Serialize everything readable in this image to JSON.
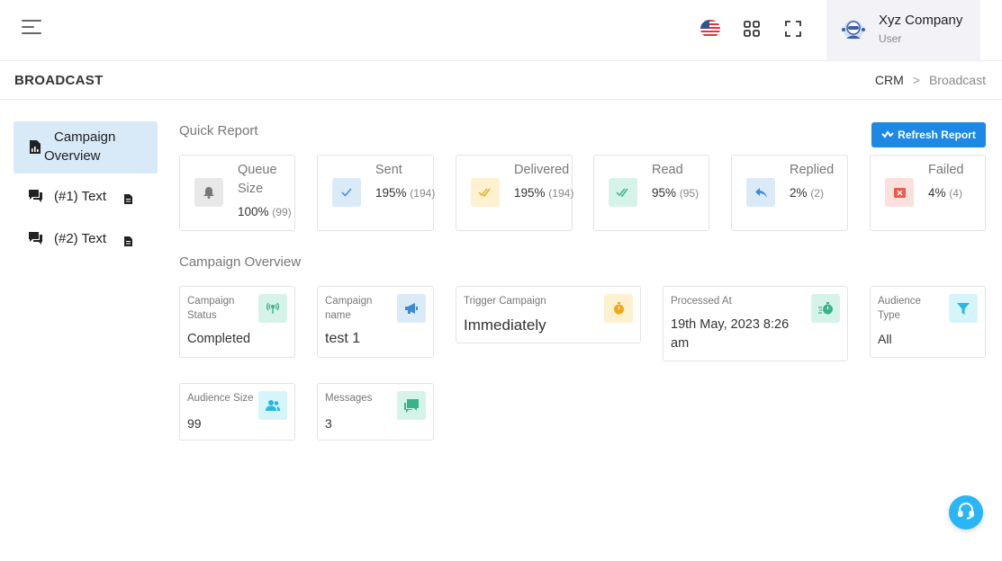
{
  "header": {
    "user_name": "Xyz Company",
    "user_role": "User",
    "icons": [
      "menu-icon",
      "us-flag-icon",
      "apps-grid-icon",
      "fullscreen-icon",
      "avatar-icon"
    ]
  },
  "page": {
    "title": "BROADCAST",
    "breadcrumb": {
      "root": "CRM",
      "separator": ">",
      "current": "Broadcast"
    }
  },
  "nav": {
    "items": [
      {
        "label_line1": "Campaign",
        "label_line2": "Overview",
        "icon": "report-icon",
        "active": true
      },
      {
        "label": "(#1) Text",
        "icon": "chat-icon",
        "suffix_icon": "document-icon"
      },
      {
        "label": "(#2) Text",
        "icon": "chat-icon",
        "suffix_icon": "document-icon"
      }
    ]
  },
  "quick_report": {
    "title": "Quick Report",
    "refresh_label": "Refresh Report",
    "cards": [
      {
        "title_line1": "Queue",
        "title_line2": "Size",
        "percent": "100%",
        "count": "(99)",
        "icon": "bell-icon",
        "color": "#e8e8e8"
      },
      {
        "title": "Sent",
        "percent": "195%",
        "count": "(194)",
        "icon": "check-icon",
        "color": "#dbeaf7"
      },
      {
        "title": "Delivered",
        "percent": "195%",
        "count": "(194)",
        "icon": "double-check-icon",
        "color": "#fdf1cf"
      },
      {
        "title": "Read",
        "percent": "95%",
        "count": "(95)",
        "icon": "double-check-icon",
        "color": "#d6f3ea"
      },
      {
        "title": "Replied",
        "percent": "2%",
        "count": "(2)",
        "icon": "reply-icon",
        "color": "#dbeaf7"
      },
      {
        "title": "Failed",
        "percent": "4%",
        "count": "(4)",
        "icon": "close-box-icon",
        "color": "#fbe0dd"
      }
    ]
  },
  "campaign_overview": {
    "title": "Campaign Overview",
    "cards": [
      {
        "label_line1": "Campaign",
        "label_line2": "Status",
        "value": "Completed",
        "icon": "broadcast-tower-icon",
        "color": "#d6f3ea"
      },
      {
        "label_line1": "Campaign",
        "label_line2": "name",
        "value": "test 1",
        "icon": "megaphone-icon",
        "color": "#dbeaf7"
      },
      {
        "label": "Trigger Campaign",
        "value": "Immediately",
        "icon": "stopwatch-icon",
        "color": "#fdf1cf"
      },
      {
        "label": "Processed At",
        "value_line1": "19th May, 2023 8:26",
        "value_line2": "am",
        "icon": "fast-timer-icon",
        "color": "#d6f3ea"
      },
      {
        "label_line1": "Audience",
        "label_line2": "Type",
        "value": "All",
        "icon": "filter-icon",
        "color": "#d5f5fb"
      },
      {
        "label": "Audience Size",
        "value": "99",
        "icon": "users-icon",
        "color": "#d5f5fb"
      },
      {
        "label": "Messages",
        "value": "3",
        "icon": "messages-icon",
        "color": "#d6f3ea"
      }
    ]
  },
  "colors": {
    "accent": "#1e88e5",
    "nav_active": "#d8eaf8",
    "support": "#29b6f6"
  }
}
